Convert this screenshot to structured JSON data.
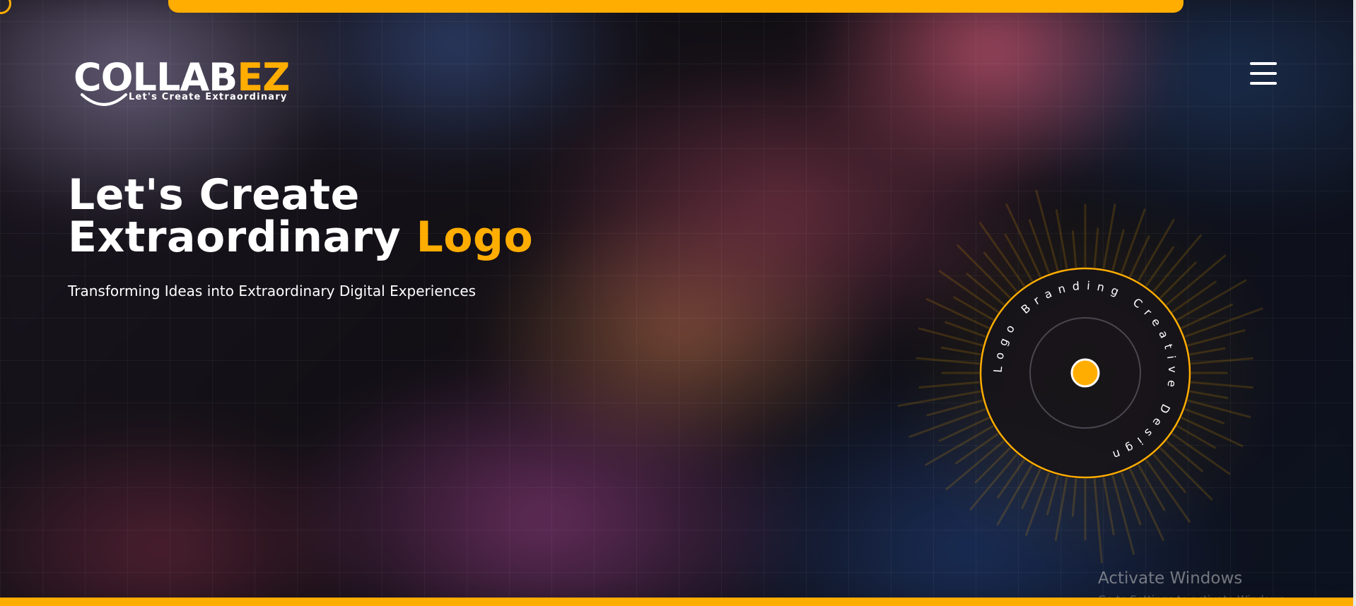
{
  "header": {
    "logo": {
      "word_main": "COLLAB",
      "word_accent": "EZ",
      "tagline": "Let's Create Extraordinary"
    },
    "menu_icon": "hamburger-menu-icon"
  },
  "hero": {
    "title_line1": "Let's Create",
    "title_line2_main": "Extraordinary ",
    "title_line2_accent": "Logo",
    "subtitle": "Transforming Ideas into Extraordinary Digital Experiences"
  },
  "badge": {
    "ring_text": "Logo Branding Creative Design "
  },
  "system": {
    "watermark_title": "Activate Windows",
    "watermark_sub": "Go to Settings to activate Windows."
  },
  "colors": {
    "accent": "#ffad00",
    "background": "#0e0d12",
    "text": "#ffffff"
  }
}
